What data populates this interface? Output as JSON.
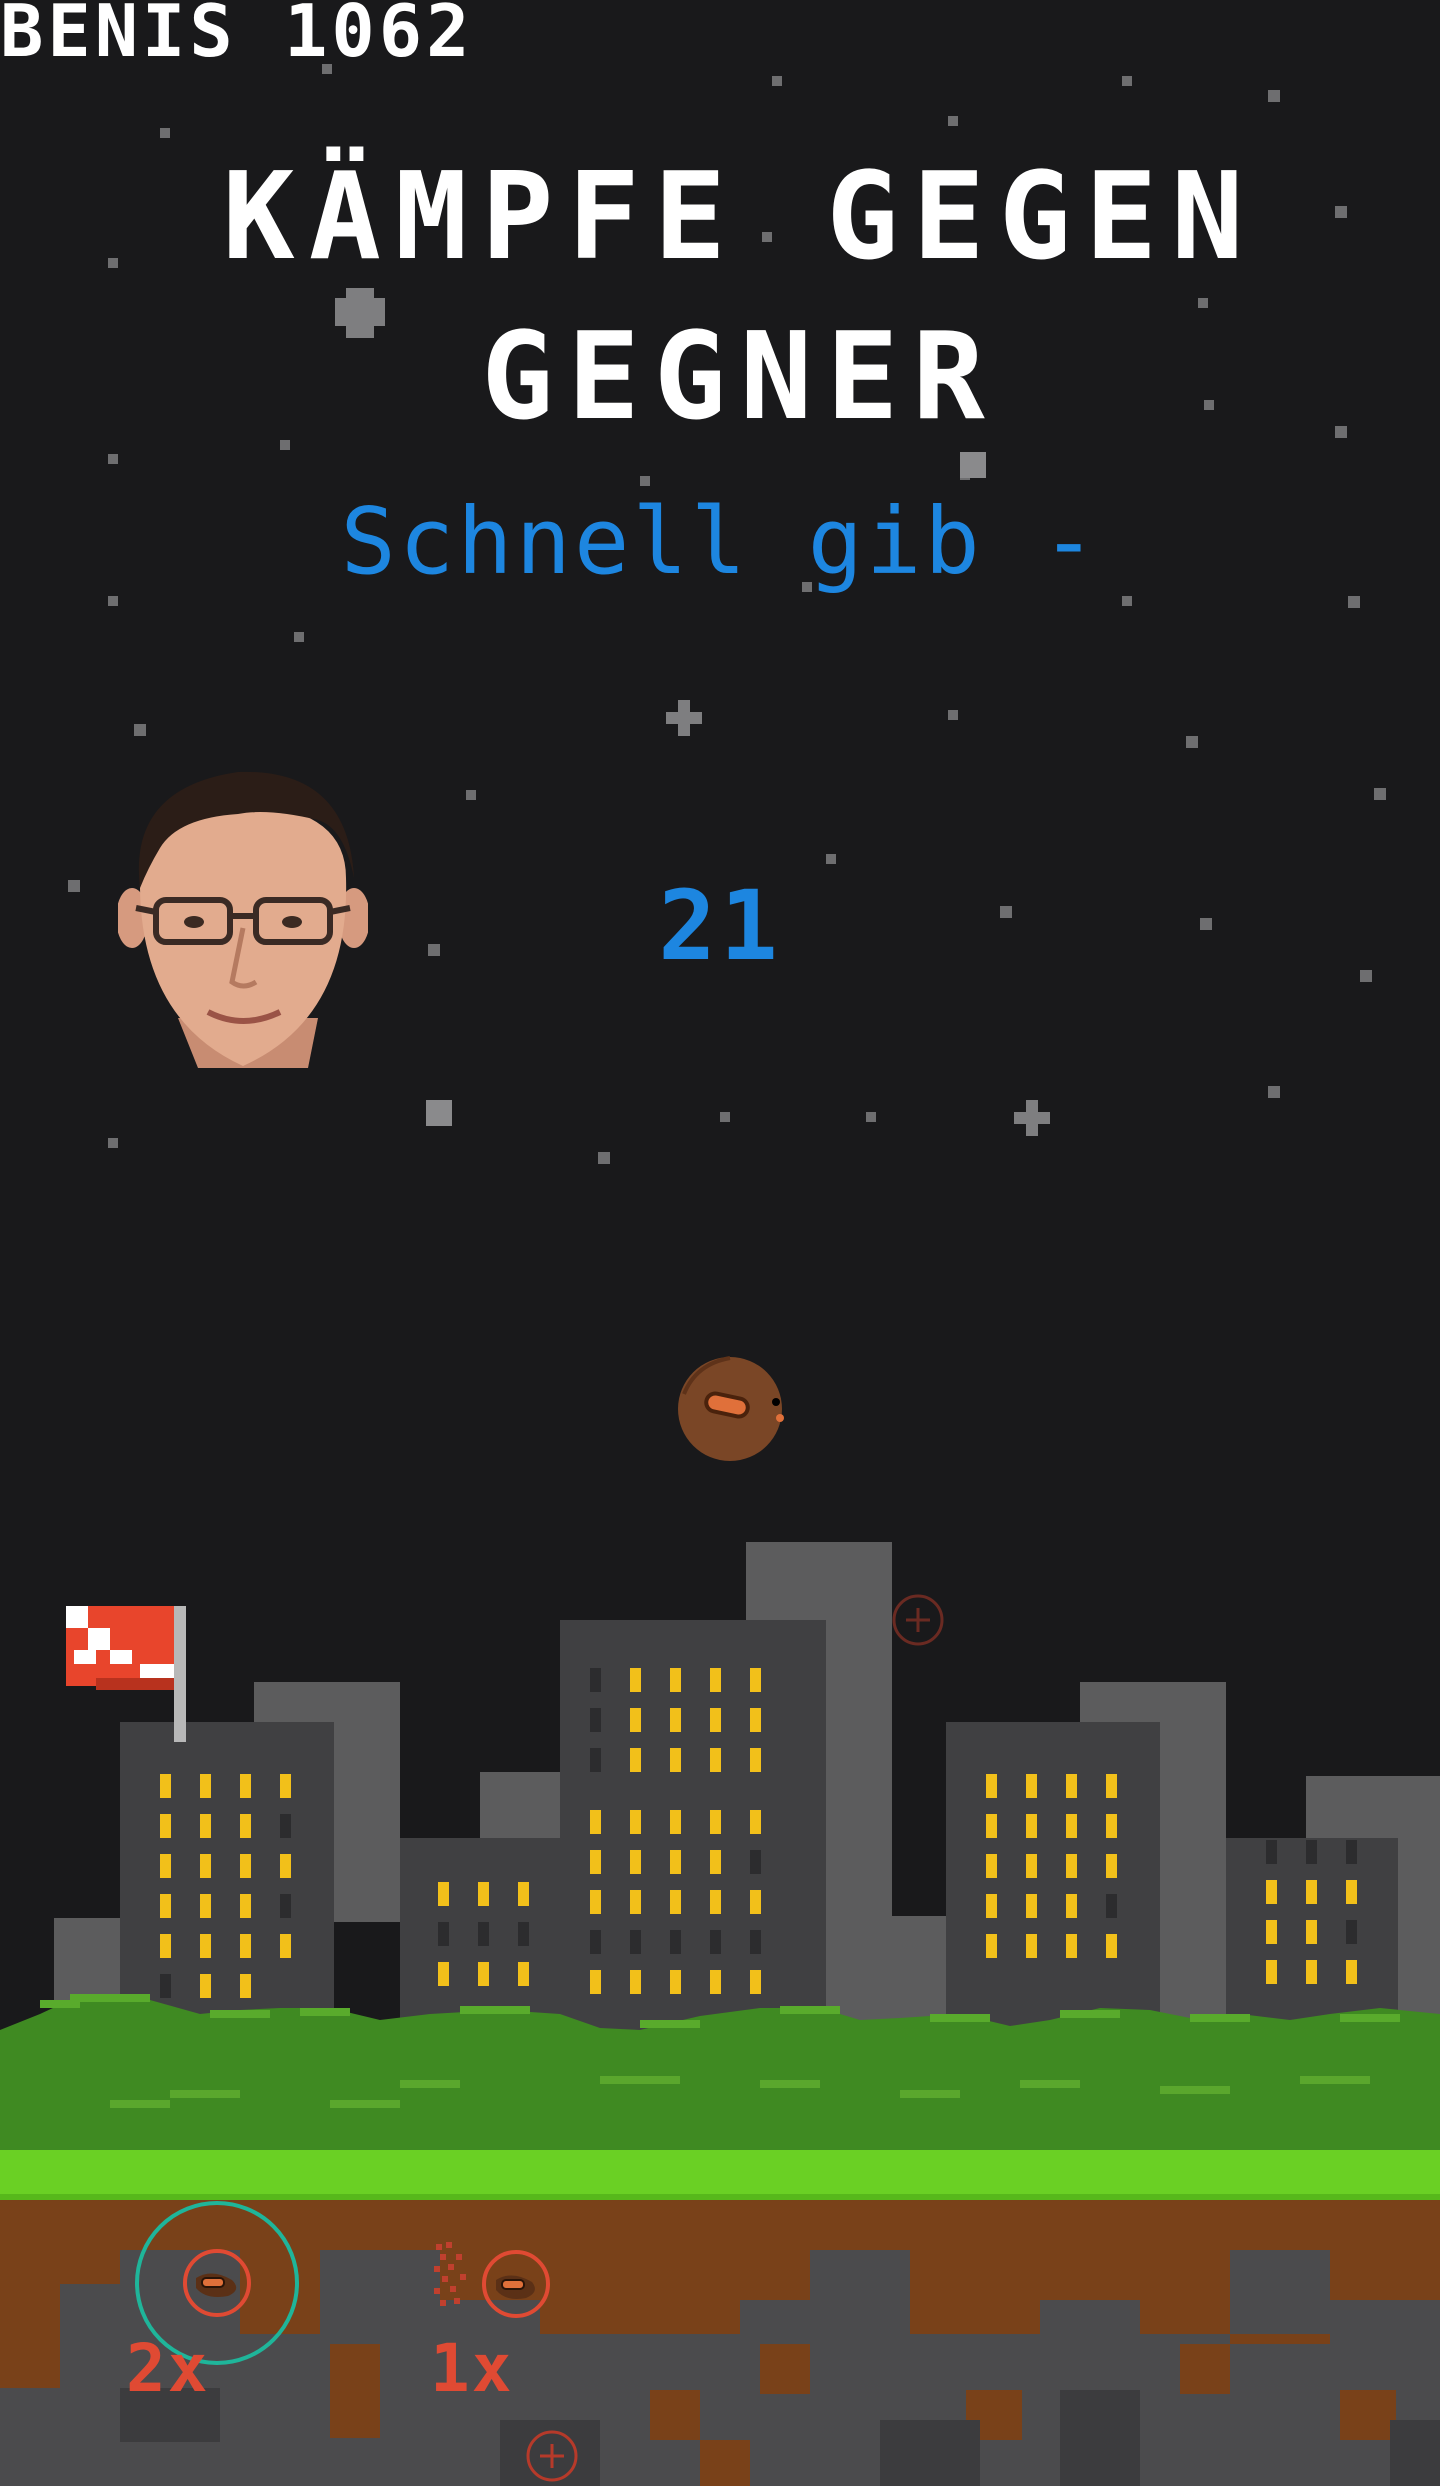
{
  "hud": {
    "score": "BENIS 1062"
  },
  "headline": {
    "line1": "KÄMPFE GEGEN",
    "line2": "GEGNER"
  },
  "prompt": "Schnell gib -",
  "enemy": {
    "hit_counter": "21",
    "portrait": "man-with-glasses-portrait"
  },
  "powerups": [
    {
      "count": "2x",
      "icon": "target-powerup-icon",
      "selected": true
    },
    {
      "count": "1x",
      "icon": "scatter-powerup-icon",
      "selected": false
    }
  ],
  "colors": {
    "background": "#19191b",
    "title": "#ffffff",
    "accent_blue": "#1d86e0",
    "powerup_red": "#e04a33",
    "selection_ring": "#1fb59a",
    "grass": "#3e8a20",
    "dirt": "#784019"
  }
}
